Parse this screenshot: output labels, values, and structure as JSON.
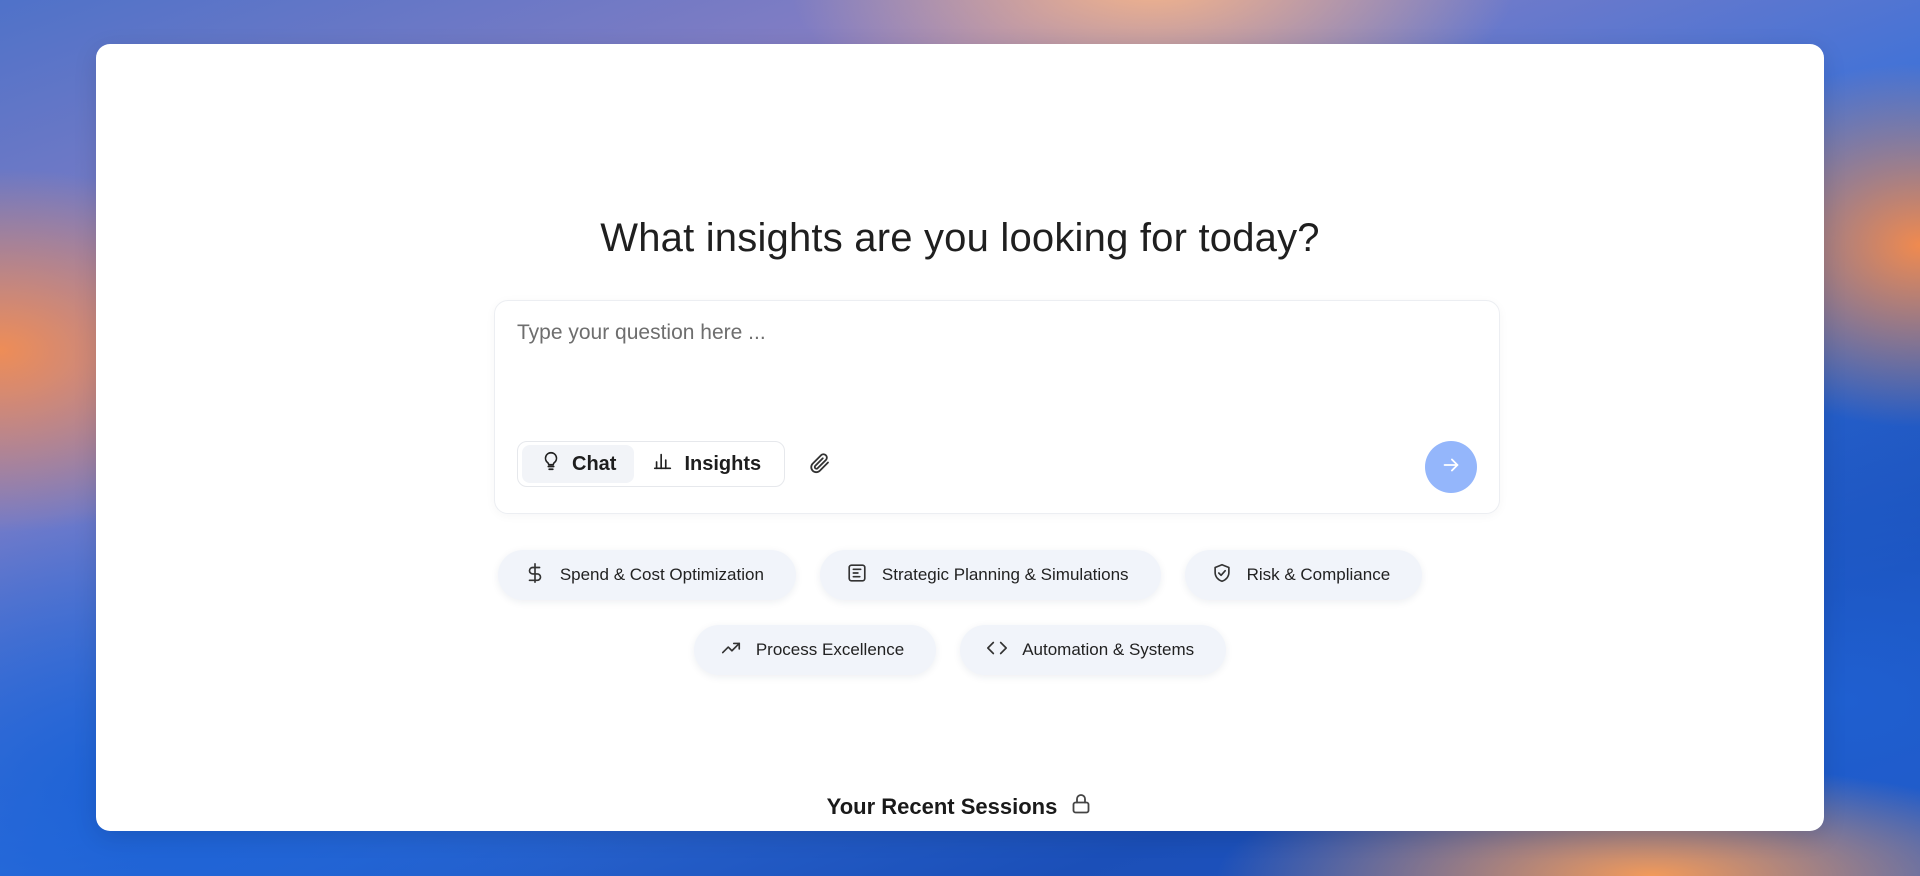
{
  "main": {
    "title": "What insights are you looking for today?",
    "composer": {
      "placeholder": "Type your question here ...",
      "value": "",
      "modes": [
        {
          "label": "Chat",
          "icon": "lightbulb-icon",
          "active": true
        },
        {
          "label": "Insights",
          "icon": "bar-chart-icon",
          "active": false
        }
      ],
      "attach_icon": "paperclip-icon",
      "send_icon": "arrow-right-icon"
    },
    "suggestions": [
      {
        "label": "Spend & Cost Optimization",
        "icon": "dollar-icon"
      },
      {
        "label": "Strategic Planning & Simulations",
        "icon": "document-chart-icon"
      },
      {
        "label": "Risk & Compliance",
        "icon": "shield-check-icon"
      },
      {
        "label": "Process Excellence",
        "icon": "trending-up-icon"
      },
      {
        "label": "Automation & Systems",
        "icon": "code-icon"
      }
    ],
    "recent_sessions": {
      "title": "Your Recent Sessions",
      "icon": "lock-icon"
    }
  },
  "colors": {
    "send_button": "#94b6fb",
    "chip_background": "#f1f4fa",
    "active_mode_background": "#f2f4f8"
  }
}
